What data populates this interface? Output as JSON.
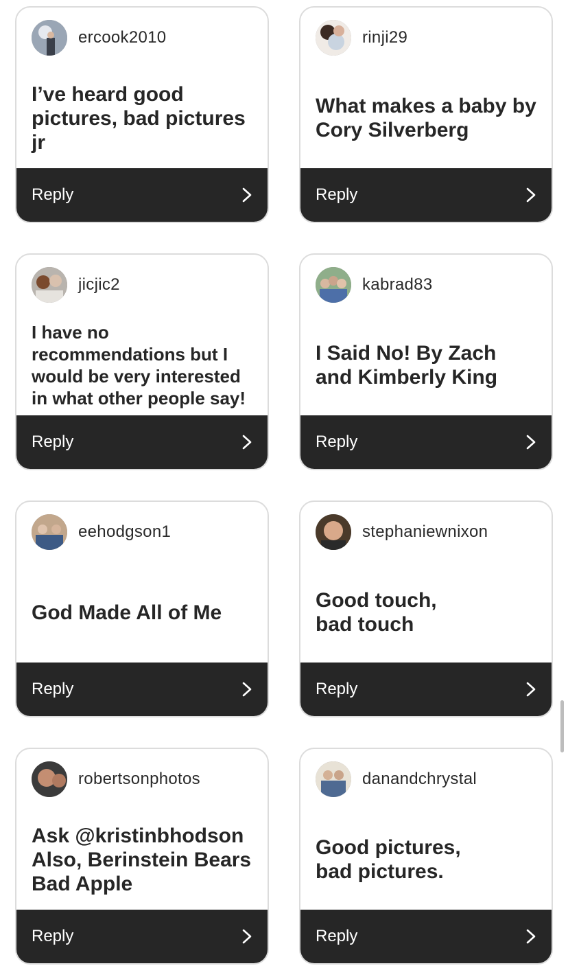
{
  "cards": [
    {
      "username": "ercook2010",
      "text": "I’ve heard good\npictures, bad pictures\njr",
      "reply": "Reply",
      "avatar": "avatar-photo"
    },
    {
      "username": "rinji29",
      "text": "What makes a baby by\nCory Silverberg",
      "reply": "Reply",
      "avatar": "avatar-photo"
    },
    {
      "username": "jicjic2",
      "text": "I have no\nrecommendations but I\nwould be very interested\nin what other people say!",
      "reply": "Reply",
      "avatar": "avatar-photo"
    },
    {
      "username": "kabrad83",
      "text": "I Said No!  By Zach\nand Kimberly King",
      "reply": "Reply",
      "avatar": "avatar-photo"
    },
    {
      "username": "eehodgson1",
      "text": "God Made All of Me",
      "reply": "Reply",
      "avatar": "avatar-photo"
    },
    {
      "username": "stephaniewnixon",
      "text": "Good touch,\nbad touch",
      "reply": "Reply",
      "avatar": "avatar-photo"
    },
    {
      "username": "robertsonphotos",
      "text": "Ask @kristinbhodson\nAlso, Berinstein Bears\nBad Apple",
      "reply": "Reply",
      "avatar": "avatar-photo"
    },
    {
      "username": "danandchrystal",
      "text": "Good pictures,\nbad pictures.",
      "reply": "Reply",
      "avatar": "avatar-photo"
    }
  ],
  "icons": {
    "reply_arrow": "chevron-right-icon"
  },
  "colors": {
    "reply_bar": "#262626",
    "card_border": "#dcdcdc",
    "text": "#262626"
  }
}
